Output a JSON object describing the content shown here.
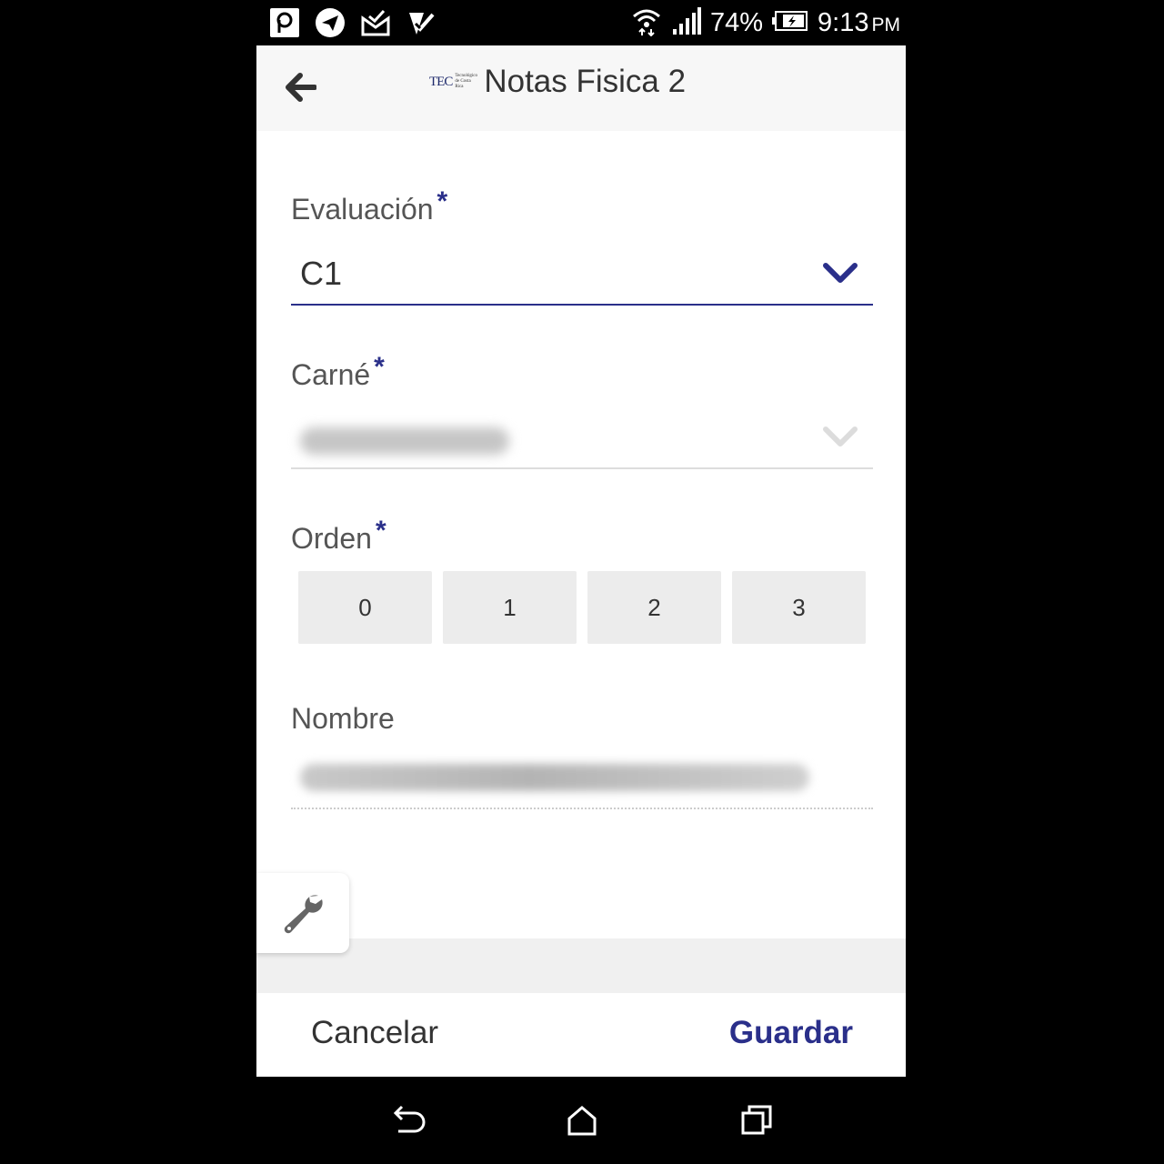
{
  "status_bar": {
    "notification_icons": [
      "pocket-icon",
      "telegram-icon",
      "mail-icon",
      "tasks-icon"
    ],
    "battery_percent": "74%",
    "time": "9:13",
    "ampm": "PM"
  },
  "header": {
    "logo_text": "TEC",
    "logo_subtext": "Tecnológico de Costa Rica",
    "title": "Notas Fisica 2"
  },
  "form": {
    "evaluacion": {
      "label": "Evaluación",
      "required": "*",
      "value": "C1"
    },
    "carne": {
      "label": "Carné",
      "required": "*"
    },
    "orden": {
      "label": "Orden",
      "required": "*",
      "options": [
        "0",
        "1",
        "2",
        "3"
      ]
    },
    "nombre": {
      "label": "Nombre"
    }
  },
  "footer": {
    "cancel_label": "Cancelar",
    "save_label": "Guardar"
  },
  "colors": {
    "accent": "#2a2f8a",
    "text": "#333333",
    "label": "#555555"
  }
}
